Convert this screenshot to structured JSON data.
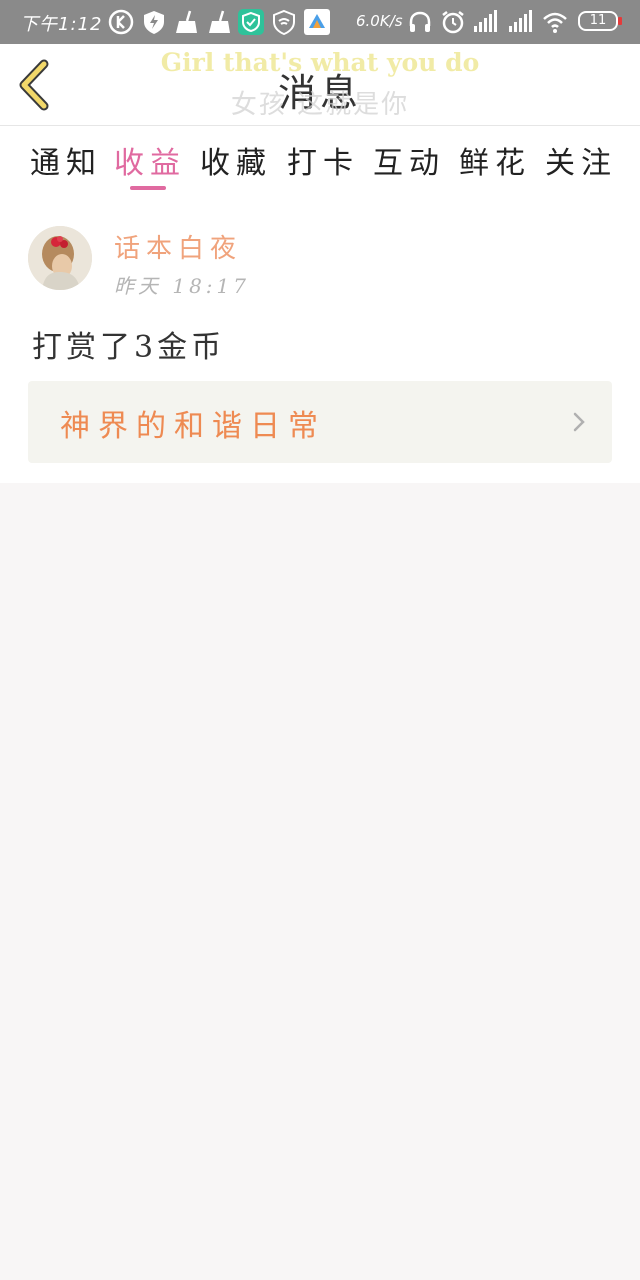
{
  "status_bar": {
    "time": "下午1:12",
    "network_speed": "6.0K/s",
    "battery": "11",
    "icons": [
      "k-circle-icon",
      "shield-bolt-icon",
      "broom-icon",
      "broom-icon",
      "security-shield-icon",
      "wifi-shield-icon",
      "app-triangle-icon",
      "headphones-icon",
      "alarm-icon",
      "signal-icon",
      "signal-icon",
      "wifi-icon",
      "battery-icon"
    ]
  },
  "header": {
    "title": "消息",
    "lyric_en": "Girl that's what you do",
    "lyric_zh": "女孩 这就是你"
  },
  "tabs": [
    {
      "label": "通知",
      "active": false
    },
    {
      "label": "收益",
      "active": true
    },
    {
      "label": "收藏",
      "active": false
    },
    {
      "label": "打卡",
      "active": false
    },
    {
      "label": "互动",
      "active": false
    },
    {
      "label": "鲜花",
      "active": false
    },
    {
      "label": "关注",
      "active": false
    }
  ],
  "message_item": {
    "username": "话本白夜",
    "timestamp": "昨天 18:17",
    "text": "打赏了3金币",
    "card_title": "神界的和谐日常"
  },
  "colors": {
    "accent_pink": "#e06aa0",
    "username_orange": "#f0a37c",
    "card_title_orange": "#ee8a52",
    "back_icon_yellow": "#f2d86a"
  }
}
